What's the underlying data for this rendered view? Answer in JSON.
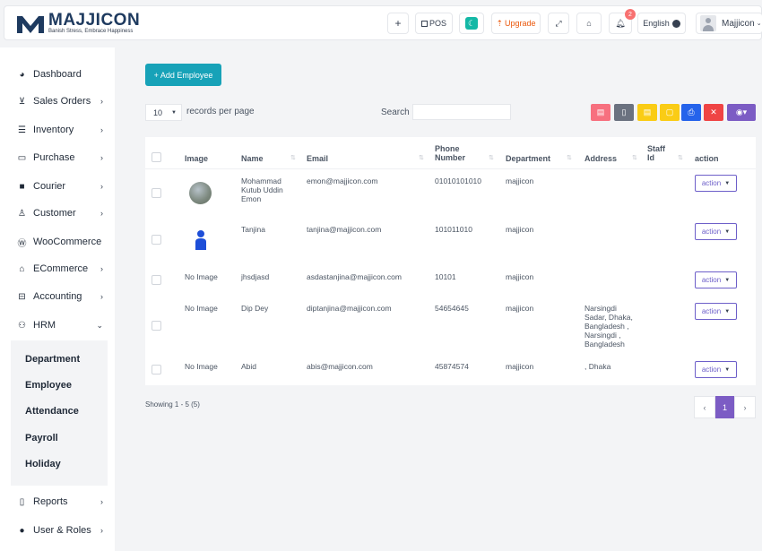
{
  "header": {
    "brand": "MAJJICON",
    "tagline": "Banish Stress, Embrace Happiness",
    "buttons": {
      "plus": "+",
      "pos": "POS",
      "upgrade": "Upgrade",
      "language": "English",
      "user": "Majjicon"
    },
    "notification_count": "2"
  },
  "sidebar": {
    "items": [
      {
        "label": "Dashboard",
        "icon": "dashboard-icon"
      },
      {
        "label": "Sales Orders",
        "icon": "cart-icon"
      },
      {
        "label": "Inventory",
        "icon": "list-icon"
      },
      {
        "label": "Purchase",
        "icon": "card-icon"
      },
      {
        "label": "Courier",
        "icon": "truck-icon"
      },
      {
        "label": "Customer",
        "icon": "user-icon"
      },
      {
        "label": "WooCommerce",
        "icon": "wordpress-icon"
      },
      {
        "label": "ECommerce",
        "icon": "bag-icon"
      },
      {
        "label": "Accounting",
        "icon": "briefcase-icon"
      },
      {
        "label": "HRM",
        "icon": "users-icon"
      },
      {
        "label": "Reports",
        "icon": "file-icon"
      },
      {
        "label": "User & Roles",
        "icon": "user-solid-icon"
      }
    ],
    "hrm_submenu": [
      "Department",
      "Employee",
      "Attendance",
      "Payroll",
      "Holiday"
    ]
  },
  "main": {
    "add_button": "+ Add Employee",
    "page_length": "10",
    "records_per_page": "records per page",
    "search_label": "Search",
    "search_value": "",
    "export_colors": [
      "#f7707f",
      "#6b7280",
      "#facc15",
      "#facc15",
      "#2563eb",
      "#ef4444",
      "#7c5cc4"
    ],
    "columns": [
      "Image",
      "Name",
      "Email",
      "Phone Number",
      "Department",
      "Address",
      "Staff Id",
      "action"
    ],
    "rows": [
      {
        "image": "",
        "name": "Mohammad Kutub Uddin Emon",
        "email": "emon@majjicon.com",
        "phone": "01010101010",
        "department": "majjicon",
        "address": "",
        "staff_id": "",
        "action": "action"
      },
      {
        "image": "",
        "name": "Tanjina",
        "email": "tanjina@majjicon.com",
        "phone": "101011010",
        "department": "majjicon",
        "address": "",
        "staff_id": "",
        "action": "action"
      },
      {
        "image": "No Image",
        "name": "jhsdjasd",
        "email": "asdastanjina@majjicon.com",
        "phone": "10101",
        "department": "majjicon",
        "address": "",
        "staff_id": "",
        "action": "action"
      },
      {
        "image": "No Image",
        "name": "Dip Dey",
        "email": "diptanjina@majjicon.com",
        "phone": "54654645",
        "department": "majjicon",
        "address": "Narsingdi Sadar, Dhaka, Bangladesh , Narsingdi , Bangladesh",
        "staff_id": "",
        "action": "action"
      },
      {
        "image": "No Image",
        "name": "Abid",
        "email": "abis@majjicon.com",
        "phone": "45874574",
        "department": "majjicon",
        "address": ", Dhaka",
        "staff_id": "",
        "action": "action"
      }
    ],
    "showing": "Showing 1 - 5 (5)",
    "pagination": {
      "prev": "‹",
      "current": "1",
      "next": "›"
    }
  }
}
